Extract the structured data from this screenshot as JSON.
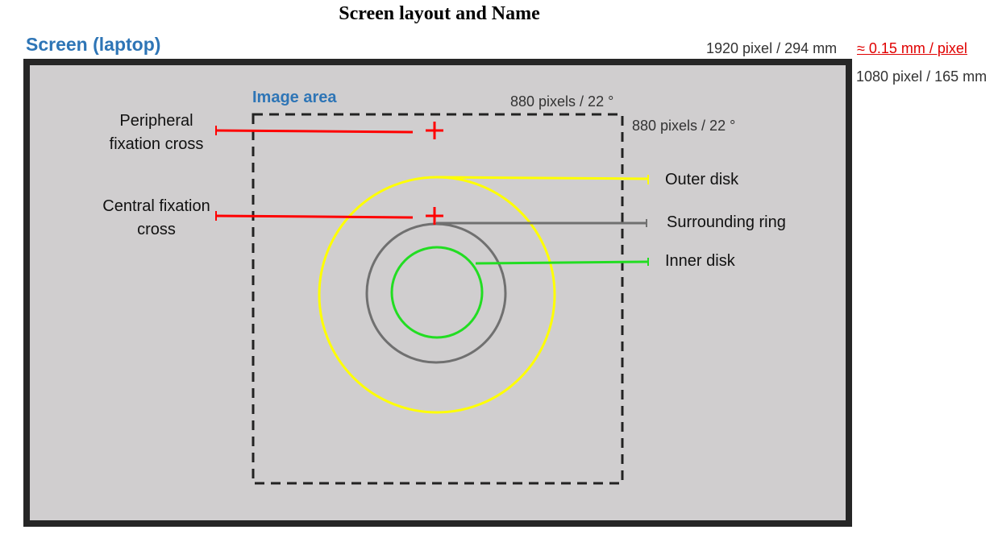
{
  "title": "Screen layout and Name",
  "screen": {
    "label": "Screen (laptop)",
    "width_spec": "1920 pixel / 294 mm",
    "pixel_size": "≈ 0.15 mm / pixel",
    "height_spec": "1080 pixel / 165 mm"
  },
  "image_area": {
    "label": "Image area",
    "width": "880 pixels  / 22 °",
    "height": "880 pixels  / 22 °"
  },
  "stimuli": {
    "peripheral_cross": {
      "label": "Peripheral fixation cross"
    },
    "central_cross": {
      "label": "Central fixation cross"
    },
    "outer_disk": {
      "label": "Outer disk"
    },
    "surrounding_ring": {
      "label": "Surrounding ring"
    },
    "inner_disk": {
      "label": "Inner disk"
    }
  },
  "colors": {
    "title_blue": "#2e75b6",
    "spec_red": "#e00000",
    "screen_bg": "#d0cecf",
    "frame": "#262626",
    "cross_red": "#ff0000",
    "outer_yellow": "#ffff00",
    "ring_gray": "#707070",
    "inner_green": "#22dd22"
  }
}
